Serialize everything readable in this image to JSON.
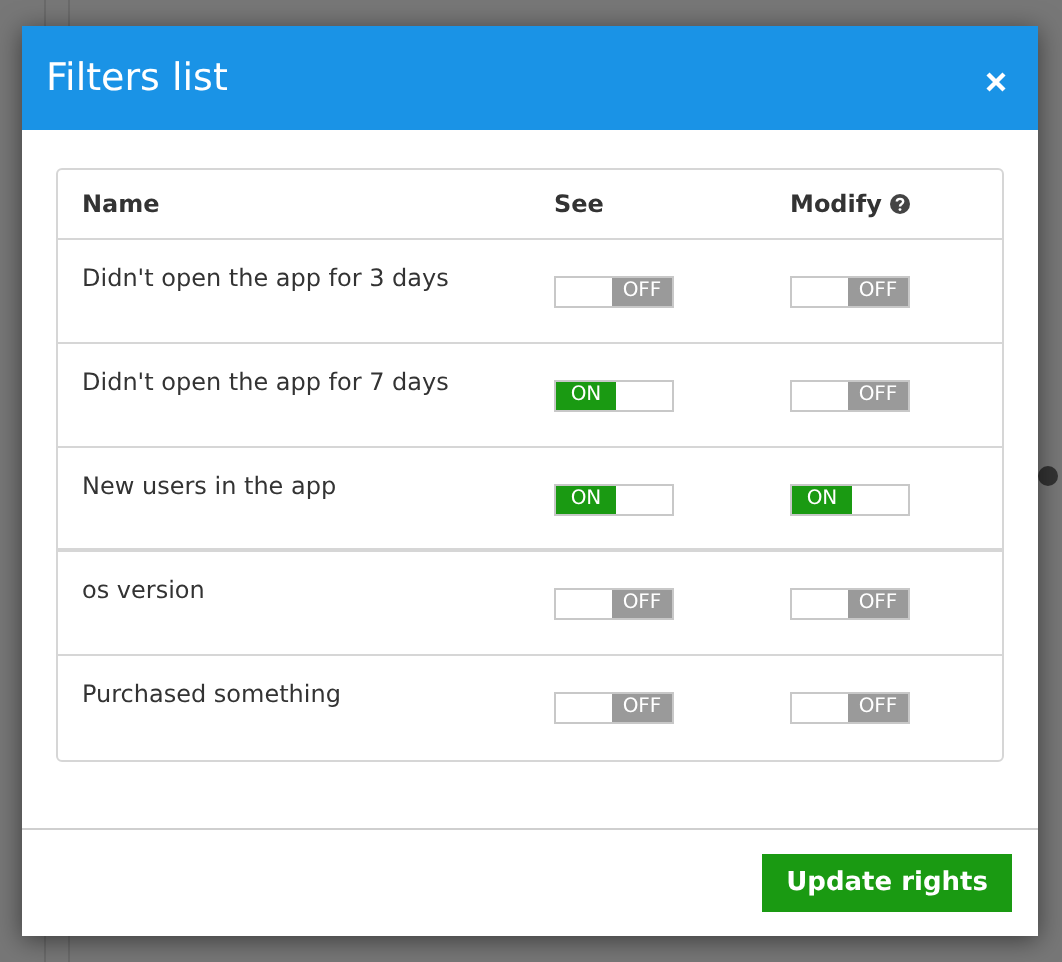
{
  "dialog": {
    "title": "Filters list",
    "columns": [
      "Name",
      "See",
      "Modify"
    ],
    "rows": [
      {
        "name": "Didn't open the app for 3 days",
        "see": {
          "on": false,
          "label": "OFF"
        },
        "modify": {
          "on": false,
          "label": "OFF"
        }
      },
      {
        "name": "Didn't open the app for 7 days",
        "see": {
          "on": true,
          "label": "ON"
        },
        "modify": {
          "on": false,
          "label": "OFF"
        }
      },
      {
        "name": "New users in the app",
        "see": {
          "on": true,
          "label": "ON"
        },
        "modify": {
          "on": true,
          "label": "ON"
        }
      },
      {
        "name": "os version",
        "see": {
          "on": false,
          "label": "OFF"
        },
        "modify": {
          "on": false,
          "label": "OFF"
        }
      },
      {
        "name": "Purchased something",
        "see": {
          "on": false,
          "label": "OFF"
        },
        "modify": {
          "on": false,
          "label": "OFF"
        }
      }
    ],
    "button": "Update rights"
  }
}
